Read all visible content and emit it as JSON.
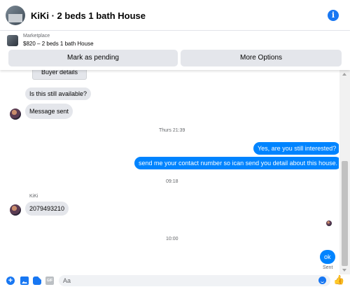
{
  "header": {
    "title": "KiKi · 2 beds 1 bath House",
    "info_symbol": "i",
    "icons": [
      "avatar",
      "info-icon"
    ]
  },
  "listing": {
    "marketplace_label": "Marketplace",
    "price_title": "$820 – 2 beds 1 bath House",
    "mark_pending_label": "Mark as pending",
    "more_options_label": "More Options"
  },
  "conversation": {
    "buyer_details_label": "Buyer details",
    "msg_available": "Is this still available?",
    "msg_sent": "Message sent",
    "time_1": "Thurs 21:39",
    "msg_out_1": "Yes, are you still interested?",
    "msg_out_2": "send me your contact number so ican send you detail about this house.",
    "time_2": "09:18",
    "sender_name": "KiKi",
    "msg_number": "2079493210",
    "time_3": "10:00",
    "msg_ok": "ok",
    "sent_status": "Sent"
  },
  "composer": {
    "placeholder": "Aa",
    "gif_label": "GIF",
    "plus_symbol": "+",
    "like_symbol": "👍"
  },
  "colors": {
    "accent": "#1877f2",
    "outgoing_bubble": "#0084ff",
    "incoming_bubble": "#e4e6eb"
  }
}
